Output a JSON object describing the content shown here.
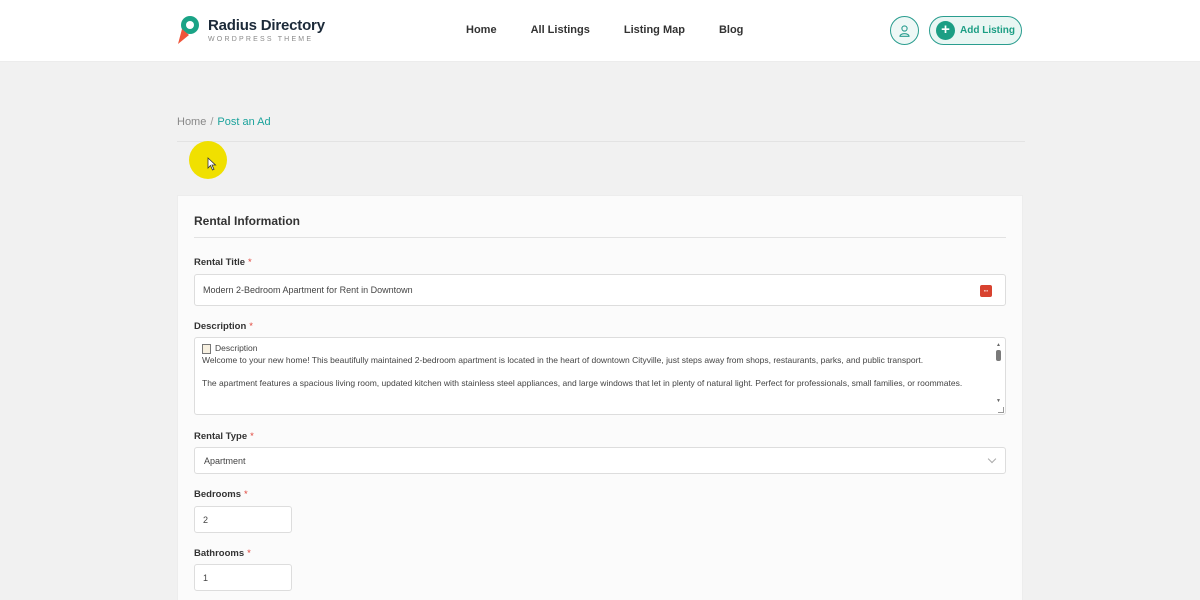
{
  "brand": {
    "name": "Radius Directory",
    "tagline": "WORDPRESS THEME"
  },
  "nav": {
    "items": [
      "Home",
      "All Listings",
      "Listing Map",
      "Blog"
    ]
  },
  "header_actions": {
    "add_listing_label": "Add Listing",
    "user_icon": "user-icon"
  },
  "breadcrumb": {
    "home": "Home",
    "separator": "/",
    "current": "Post an Ad"
  },
  "form": {
    "section_title": "Rental Information",
    "required_mark": "*",
    "rental_title": {
      "label": "Rental Title",
      "value": "Modern 2-Bedroom Apartment for Rent in Downtown"
    },
    "description": {
      "label": "Description",
      "header": "Description",
      "paragraph1": "Welcome to your new home! This beautifully maintained 2-bedroom apartment is located in the heart of downtown Cityville, just steps away from shops, restaurants, parks, and public transport.",
      "paragraph2": "The apartment features a spacious living room, updated kitchen with stainless steel appliances, and large windows that let in plenty of natural light. Perfect for professionals, small families, or roommates."
    },
    "rental_type": {
      "label": "Rental Type",
      "value": "Apartment"
    },
    "bedrooms": {
      "label": "Bedrooms",
      "value": "2"
    },
    "bathrooms": {
      "label": "Bathrooms",
      "value": "1"
    }
  },
  "colors": {
    "accent": "#1c9e84",
    "breadcrumb_active": "#1ca39c",
    "required": "#e0443a",
    "highlight": "#f0e000"
  }
}
